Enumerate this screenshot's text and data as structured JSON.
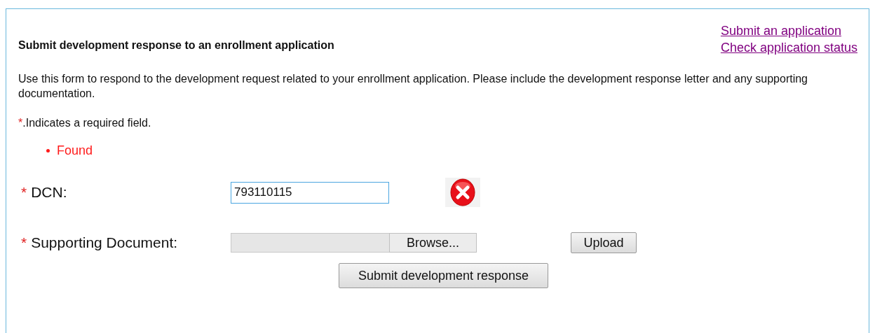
{
  "header": {
    "title": "Submit development response to an enrollment application",
    "links": [
      "Submit an application",
      "Check application status"
    ]
  },
  "description": "Use this form to respond to the development request related to your enrollment application. Please include the development response letter and any supporting documentation.",
  "required_note": {
    "mark": "*",
    "text": ".Indicates a required field."
  },
  "messages": [
    "Found"
  ],
  "fields": [
    {
      "kind": "text",
      "mark": "*",
      "label": "DCN:",
      "value": "793110115",
      "focused": true,
      "error": true
    },
    {
      "kind": "file",
      "mark": "*",
      "label": "Supporting Document:",
      "browse": "Browse...",
      "upload": "Upload"
    }
  ],
  "submit": "Submit development response"
}
